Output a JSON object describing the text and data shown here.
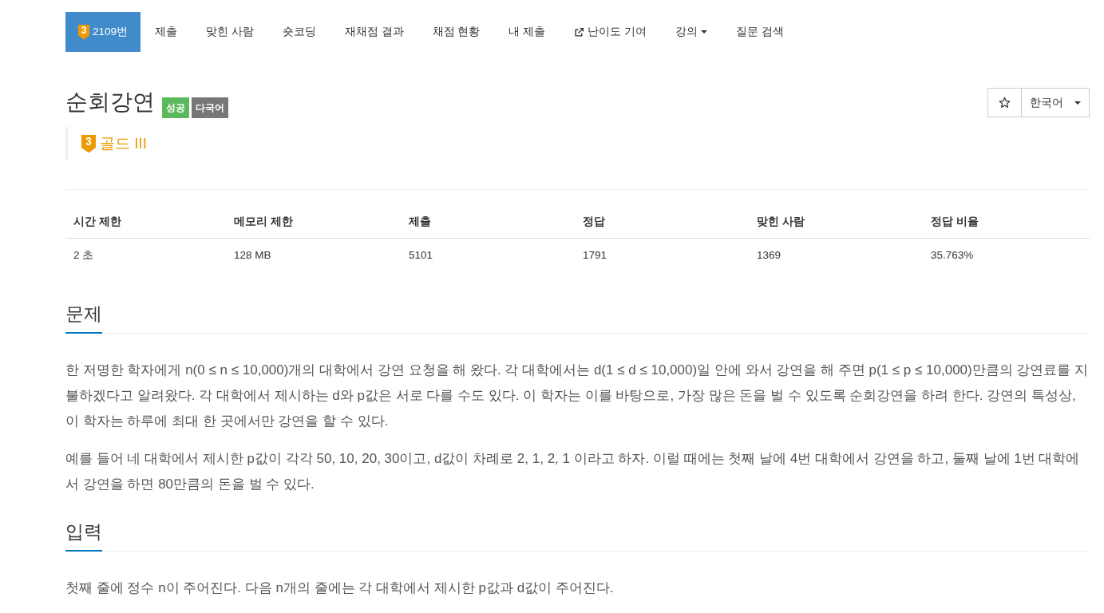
{
  "nav": {
    "items": [
      {
        "kind": "problem",
        "tier": "3",
        "label": "2109번",
        "selected": true
      },
      {
        "kind": "link",
        "label": "제출",
        "selected": false
      },
      {
        "kind": "link",
        "label": "맞힌 사람",
        "selected": false
      },
      {
        "kind": "link",
        "label": "숏코딩",
        "selected": false
      },
      {
        "kind": "link",
        "label": "재채점 결과",
        "selected": false
      },
      {
        "kind": "link",
        "label": "채점 현황",
        "selected": false
      },
      {
        "kind": "link",
        "label": "내 제출",
        "selected": false
      },
      {
        "kind": "external",
        "label": "난이도 기여",
        "selected": false
      },
      {
        "kind": "dropdown",
        "label": "강의",
        "selected": false
      },
      {
        "kind": "link",
        "label": "질문 검색",
        "selected": false
      }
    ]
  },
  "problem": {
    "title": "순회강연",
    "tags": [
      {
        "label": "성공",
        "color": "#5cb85c"
      },
      {
        "label": "다국어",
        "color": "#777777"
      }
    ],
    "tier": {
      "number": "3",
      "label": "골드 III",
      "color": "#ec9a00"
    },
    "starred": false,
    "language": {
      "value": "한국어"
    }
  },
  "table": {
    "columns": [
      "시간 제한",
      "메모리 제한",
      "제출",
      "정답",
      "맞힌 사람",
      "정답 비율"
    ],
    "rows": [
      [
        "2 초",
        "128 MB",
        "5101",
        "1791",
        "1369",
        "35.763%"
      ]
    ]
  },
  "sections": [
    {
      "heading": "문제",
      "paragraphs": [
        "한 저명한 학자에게 n(0 ≤ n ≤ 10,000)개의 대학에서 강연 요청을 해 왔다. 각 대학에서는 d(1 ≤ d ≤ 10,000)일 안에 와서 강연을 해 주면 p(1 ≤ p ≤ 10,000)만큼의 강연료를 지불하겠다고 알려왔다. 각 대학에서 제시하는 d와 p값은 서로 다를 수도 있다. 이 학자는 이를 바탕으로, 가장 많은 돈을 벌 수 있도록 순회강연을 하려 한다. 강연의 특성상, 이 학자는 하루에 최대 한 곳에서만 강연을 할 수 있다.",
        "예를 들어 네 대학에서 제시한 p값이 각각 50, 10, 20, 30이고, d값이 차례로 2, 1, 2, 1 이라고 하자. 이럴 때에는 첫째 날에 4번 대학에서 강연을 하고, 둘째 날에 1번 대학에서 강연을 하면 80만큼의 돈을 벌 수 있다."
      ]
    },
    {
      "heading": "입력",
      "paragraphs": [
        "첫째 줄에 정수 n이 주어진다. 다음 n개의 줄에는 각 대학에서 제시한 p값과 d값이 주어진다."
      ]
    }
  ]
}
